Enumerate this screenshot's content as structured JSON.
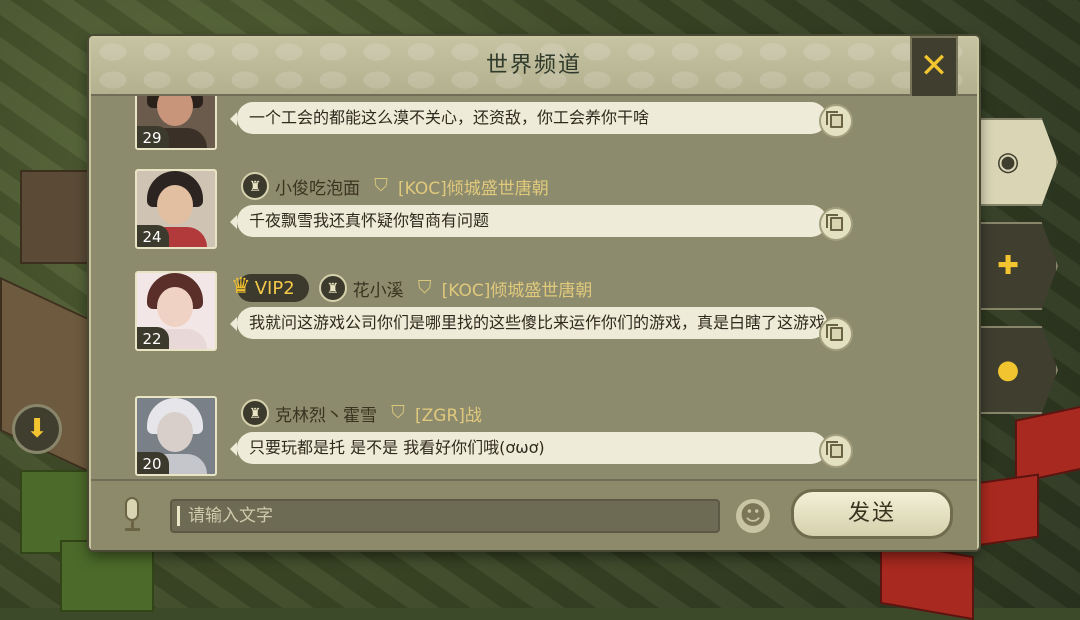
{
  "panel": {
    "title": "世界频道",
    "close_icon": "✕"
  },
  "messages": [
    {
      "level": "29",
      "has_name": false,
      "name": "",
      "guild": "",
      "vip": "",
      "text": "一个工会的都能这么漠不关心，还资敌，你工会养你干啥"
    },
    {
      "level": "24",
      "has_name": true,
      "name": "小俊吃泡面",
      "guild": "[KOC]倾城盛世唐朝",
      "vip": "",
      "text": "千夜飘雪我还真怀疑你智商有问题"
    },
    {
      "level": "22",
      "has_name": true,
      "name": "花小溪",
      "guild": "[KOC]倾城盛世唐朝",
      "vip": "VIP2",
      "text": "我就问这游戏公司你们是哪里找的这些傻比来运作你们的游戏，真是白瞎了这游戏"
    },
    {
      "level": "20",
      "has_name": true,
      "name": "克林烈丶霍雪",
      "guild": "[ZGR]战",
      "vip": "",
      "text": "只要玩都是托 是不是 我看好你们哦(ơωơ)"
    }
  ],
  "input": {
    "placeholder": "请输入文字"
  },
  "send": {
    "label": "发送"
  },
  "side_tabs": [
    {
      "icon": "globe-icon",
      "glyph": "◉"
    },
    {
      "icon": "guild-shield-icon",
      "glyph": "✚"
    },
    {
      "icon": "private-chat-icon",
      "glyph": "●"
    }
  ],
  "icons": {
    "scroll_down": "⬇",
    "emoji": "☻",
    "crown": "♛",
    "shield": "⛉",
    "rank": "♜"
  },
  "colors": {
    "accent": "#f1c430",
    "guild_text": "#e0c97c",
    "panel": "#8f8d6f"
  }
}
